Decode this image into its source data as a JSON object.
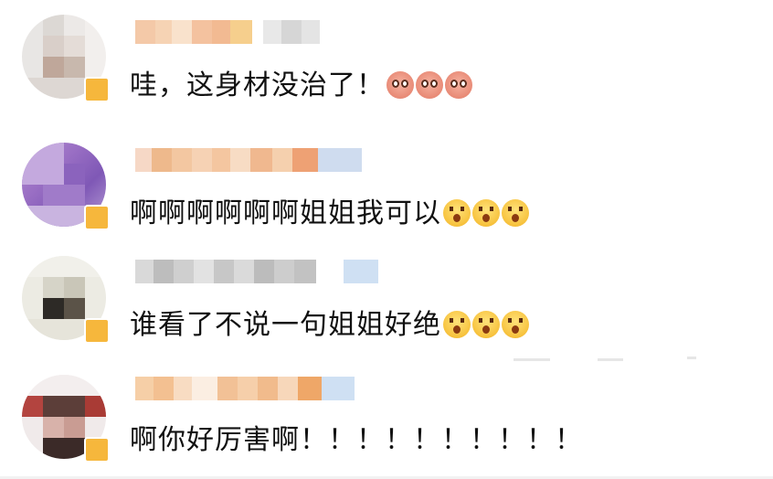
{
  "comments": [
    {
      "text": "哇，这身材没治了！",
      "emojis": [
        "pink-face-icon",
        "pink-face-icon",
        "pink-face-icon"
      ]
    },
    {
      "text": "啊啊啊啊啊啊姐姐我可以",
      "emojis": [
        "hug-face-icon",
        "hug-face-icon",
        "hug-face-icon"
      ]
    },
    {
      "text": "谁看了不说一句姐姐好绝",
      "emojis": [
        "hug-face-icon",
        "hug-face-icon",
        "hug-face-icon"
      ]
    },
    {
      "text": "啊你好厉害啊！！！！！！！！！！"
    }
  ],
  "colors": {
    "text": "#111111",
    "badge": "#f6b73c",
    "divider": "#e6e6e6"
  }
}
